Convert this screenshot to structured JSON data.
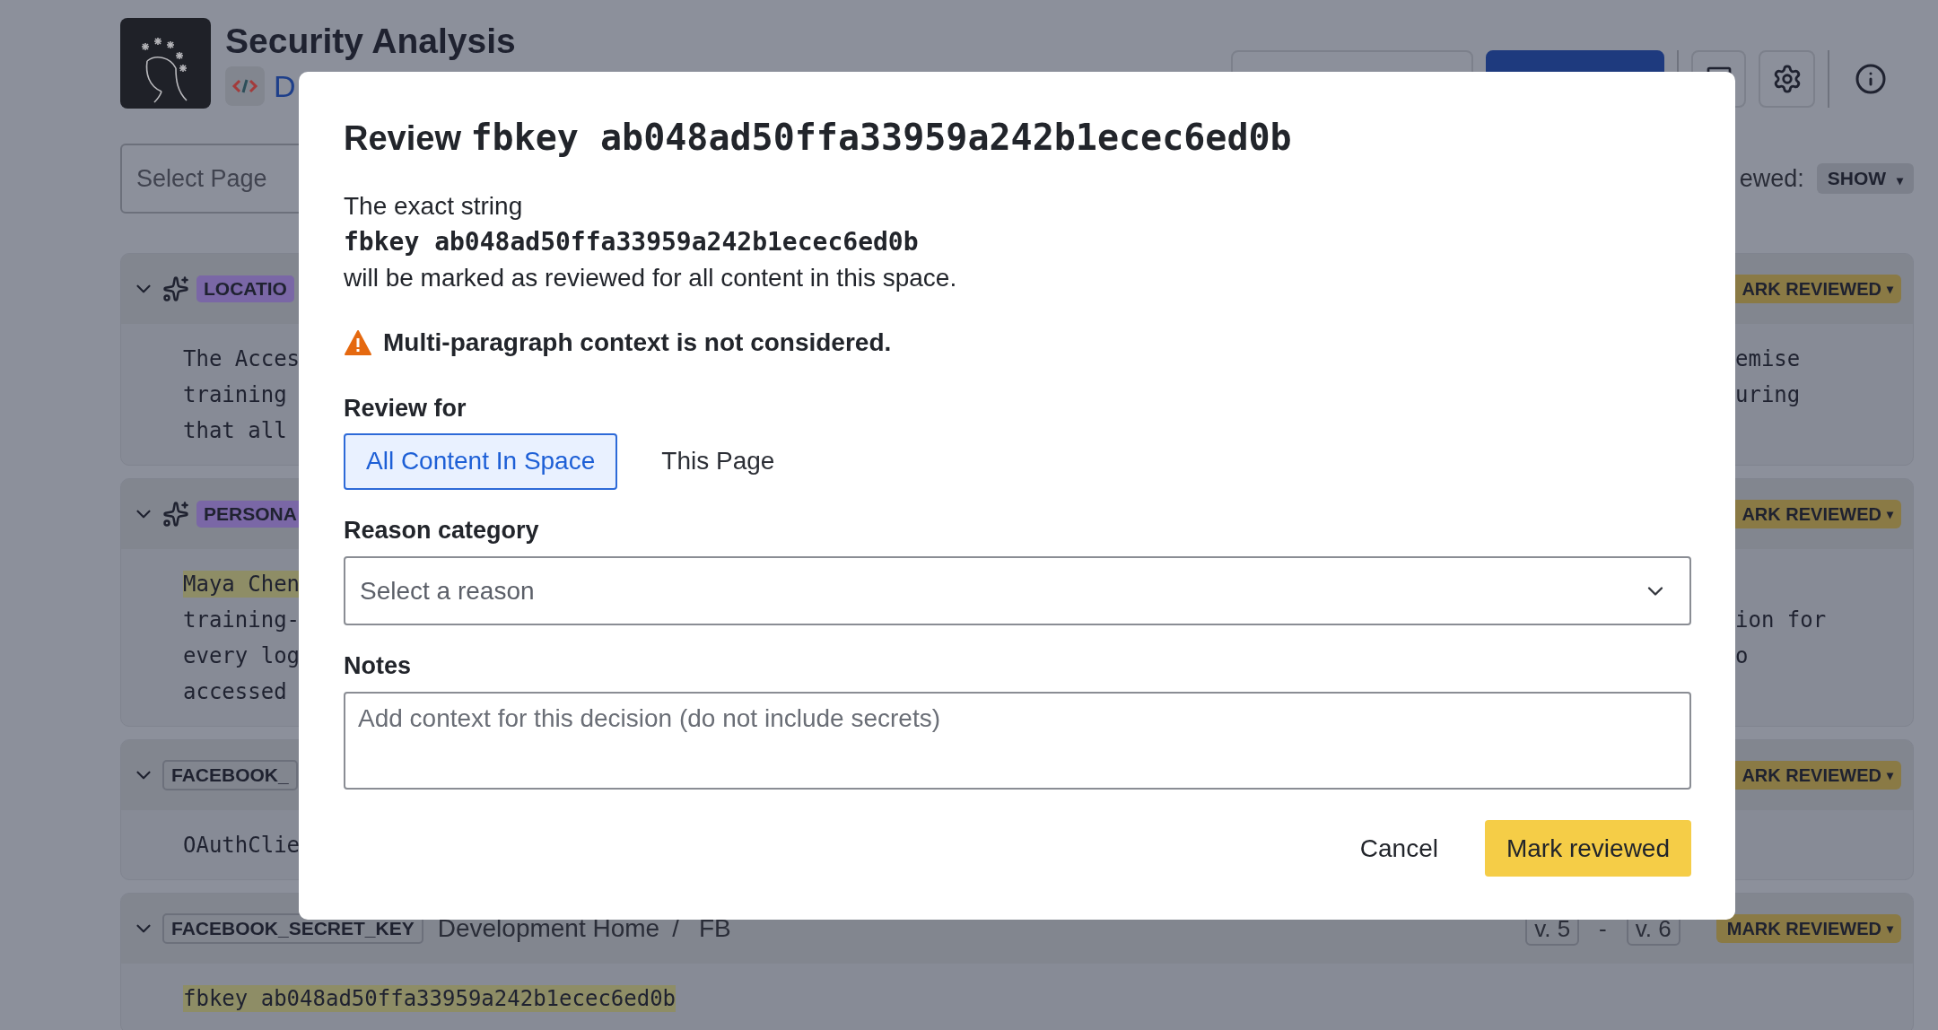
{
  "header": {
    "title": "Security Analysis",
    "breadcrumb": "D"
  },
  "filters": {
    "page_select": {
      "placeholder": "Select Page"
    },
    "reviewed_label": "ewed:",
    "reviewed_value": "SHOW",
    "caret": "▾"
  },
  "cards": [
    {
      "kind": "ai",
      "tag": "LOCATIO",
      "action": "ARK REVIEWED",
      "caret": "▾",
      "lines": [
        {
          "left": "The Acces",
          "right": "emise",
          "highlighted": false
        },
        {
          "left": "training",
          "right": "uring",
          "highlighted": false
        },
        {
          "left": "that all",
          "highlighted": false
        }
      ]
    },
    {
      "kind": "ai",
      "tag": "PERSONA",
      "action": "ARK REVIEWED",
      "caret": "▾",
      "lines": [
        {
          "left": "Maya Chen",
          "highlighted": true
        },
        {
          "left": "training-",
          "right": "ion for",
          "highlighted": false
        },
        {
          "left": "every log",
          "right": "o",
          "highlighted": false
        },
        {
          "left": "accessed",
          "highlighted": false
        }
      ]
    },
    {
      "kind": "secret",
      "tag": "FACEBOOK_",
      "action": "ARK REVIEWED",
      "caret": "▾",
      "lines": [
        {
          "left": "OAuthClie",
          "highlighted": false
        }
      ]
    },
    {
      "kind": "secret",
      "tag": "FACEBOOK_SECRET_KEY",
      "location": [
        "Development Home",
        "/",
        "FB"
      ],
      "versions": [
        "v. 5",
        "-",
        "v. 6"
      ],
      "action": "MARK REVIEWED",
      "caret": "▾",
      "lines": [
        {
          "left": "fbkey ab048ad50ffa33959a242b1ecec6ed0b",
          "highlighted": true
        }
      ]
    }
  ],
  "dialog": {
    "title_label": "Review",
    "title_code": "fbkey ab048ad50ffa33959a242b1ecec6ed0b",
    "intro": "The exact string",
    "code": "fbkey ab048ad50ffa33959a242b1ecec6ed0b",
    "outro": "will be marked as reviewed for all content in this space.",
    "warning": "Multi-paragraph context is not considered.",
    "review_for": {
      "label": "Review for",
      "options": [
        {
          "label": "All Content In Space",
          "selected": true
        },
        {
          "label": "This Page",
          "selected": false
        }
      ]
    },
    "reason": {
      "label": "Reason category",
      "placeholder": "Select a reason"
    },
    "notes": {
      "label": "Notes",
      "placeholder": "Add context for this decision (do not include secrets)"
    },
    "buttons": [
      {
        "label": "Cancel",
        "kind": "secondary"
      },
      {
        "label": "Mark reviewed",
        "kind": "primary"
      }
    ]
  }
}
